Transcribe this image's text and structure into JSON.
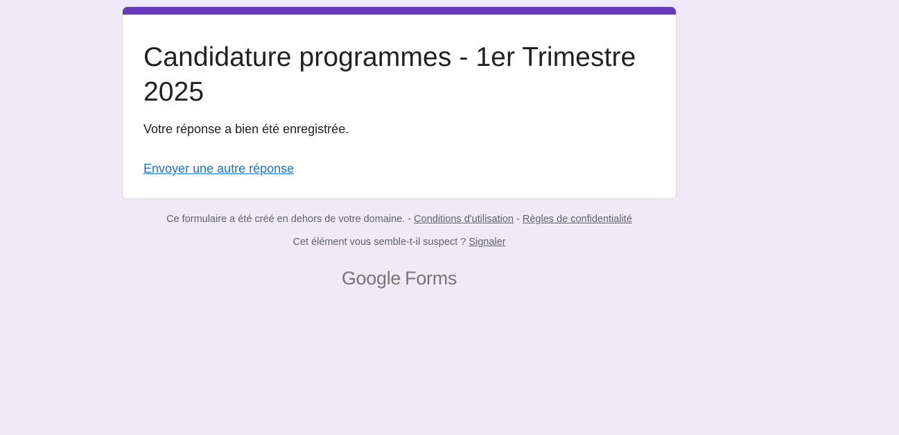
{
  "form": {
    "title": "Candidature programmes - 1er Trimestre 2025",
    "confirmation_message": "Votre réponse a bien été enregistrée.",
    "submit_another_link": "Envoyer une autre réponse"
  },
  "footer": {
    "domain_notice": "Ce formulaire a été créé en dehors de votre domaine.",
    "separator": " - ",
    "terms_link": "Conditions d'utilisation",
    "privacy_link": "Règles de confidentialité",
    "suspect_question": "Cet élément vous semble-t-il suspect ?",
    "report_link": "Signaler"
  },
  "branding": {
    "google": "Google",
    "forms": "Forms"
  },
  "colors": {
    "background": "#efe9f8",
    "accent": "#673ab7",
    "link": "#1a73e8",
    "text": "#202124",
    "muted": "#5f6368"
  }
}
